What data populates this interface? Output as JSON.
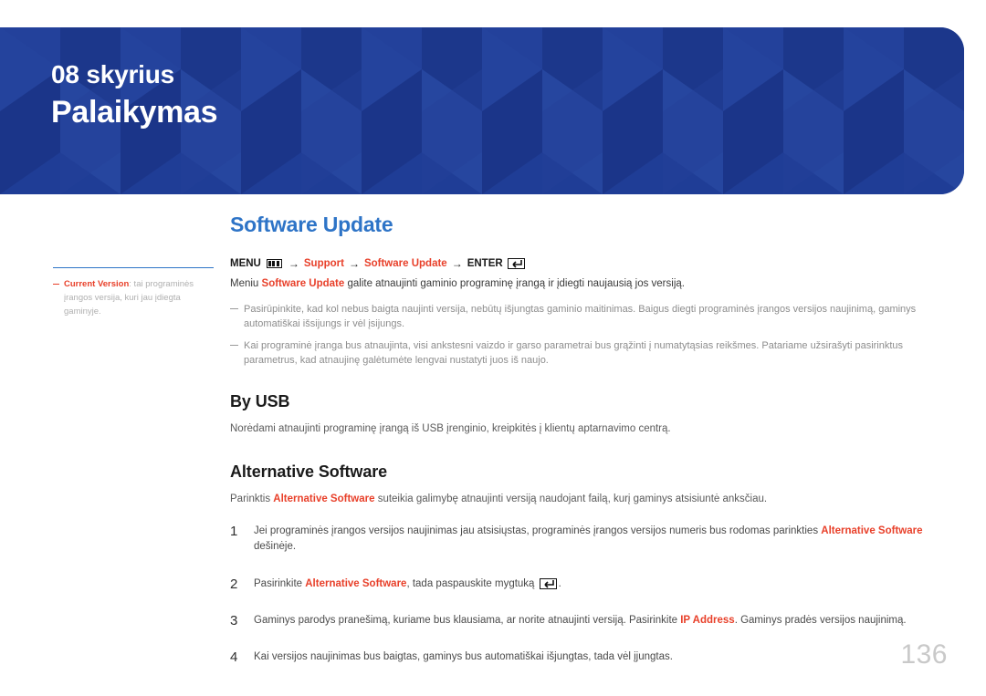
{
  "header": {
    "chapter_kicker": "08 skyrius",
    "chapter_title": "Palaikymas",
    "background_color": "#1f3d96"
  },
  "main": {
    "section_title": "Software Update",
    "section_title_color": "#2e74c7",
    "menu_path": {
      "menu_label": "MENU",
      "menu_icon": "menu-bars-icon",
      "arrow1": "→",
      "support_label": "Support",
      "arrow2": "→",
      "software_update_label": "Software Update",
      "arrow3": "→",
      "enter_label": "ENTER",
      "enter_icon": "enter-return-icon",
      "accent_color": "#e8402a"
    },
    "intro": {
      "prefix": "Meniu ",
      "bold_red": "Software Update",
      "suffix": " galite atnaujinti gaminio programinę įrangą ir įdiegti naujausią jos versiją."
    },
    "notes": [
      "Pasirūpinkite, kad kol nebus baigta naujinti versija, nebūtų išjungtas gaminio maitinimas. Baigus diegti programinės įrangos versijos naujinimą, gaminys automatiškai išsijungs ir vėl įsijungs.",
      "Kai programinė įranga bus atnaujinta, visi ankstesni vaizdo ir garso parametrai bus grąžinti į numatytąsias reikšmes. Patariame užsirašyti pasirinktus parametrus, kad atnaujinę galėtumėte lengvai nustatyti juos iš naujo."
    ],
    "by_usb": {
      "title": "By USB",
      "paragraph": "Norėdami atnaujinti programinę įrangą iš USB įrenginio, kreipkitės į klientų aptarnavimo centrą."
    },
    "alternative_software": {
      "title": "Alternative Software",
      "intro_prefix": "Parinktis ",
      "intro_bold": "Alternative Software",
      "intro_suffix": " suteikia galimybę atnaujinti versiją naudojant failą, kurį gaminys atsisiuntė anksčiau.",
      "steps": [
        {
          "num": "1",
          "prefix": "Jei programinės įrangos versijos naujinimas jau atsisiųstas, programinės įrangos versijos numeris bus rodomas parinkties ",
          "bold": "Alternative Software",
          "suffix": " dešinėje."
        },
        {
          "num": "2",
          "prefix": "Pasirinkite ",
          "bold": "Alternative Software",
          "suffix": ", tada paspauskite mygtuką ",
          "has_enter_icon": true,
          "tail": "."
        },
        {
          "num": "3",
          "prefix": "Gaminys parodys pranešimą, kuriame bus klausiama, ar norite atnaujinti versiją. Pasirinkite ",
          "bold": "IP Address",
          "suffix": ". Gaminys pradės versijos naujinimą."
        },
        {
          "num": "4",
          "prefix": "Kai versijos naujinimas bus baigtas, gaminys bus automatiškai išjungtas, tada vėl įjungtas.",
          "bold": "",
          "suffix": ""
        }
      ]
    }
  },
  "sidebar": {
    "note": {
      "bold_red": "Current Version",
      "rest": ": tai programinės įrangos versija, kuri jau įdiegta gaminyje."
    }
  },
  "footer": {
    "page_number": "136"
  }
}
